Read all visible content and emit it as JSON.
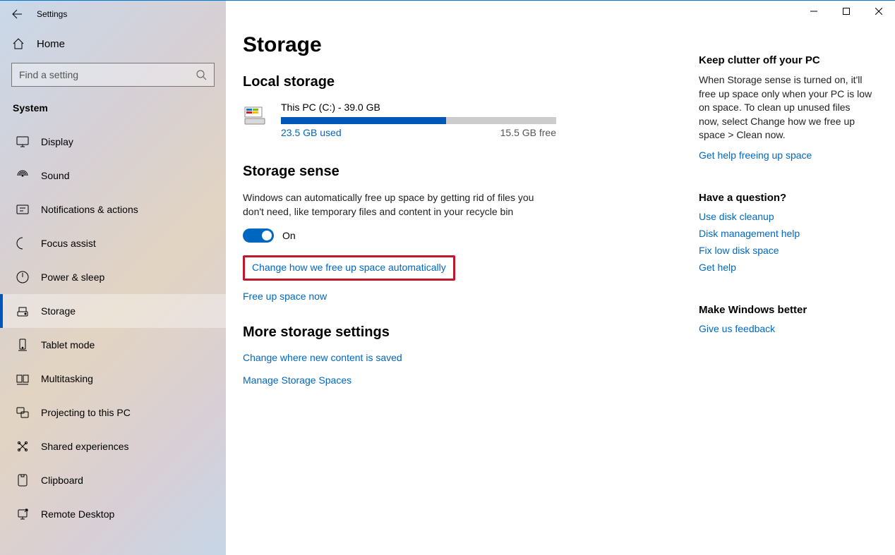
{
  "window": {
    "title": "Settings"
  },
  "sidebar": {
    "home": "Home",
    "search_placeholder": "Find a setting",
    "category": "System",
    "items": [
      {
        "label": "Display"
      },
      {
        "label": "Sound"
      },
      {
        "label": "Notifications & actions"
      },
      {
        "label": "Focus assist"
      },
      {
        "label": "Power & sleep"
      },
      {
        "label": "Storage"
      },
      {
        "label": "Tablet mode"
      },
      {
        "label": "Multitasking"
      },
      {
        "label": "Projecting to this PC"
      },
      {
        "label": "Shared experiences"
      },
      {
        "label": "Clipboard"
      },
      {
        "label": "Remote Desktop"
      }
    ],
    "selected_index": 5
  },
  "main": {
    "title": "Storage",
    "local_heading": "Local storage",
    "disk": {
      "name": "This PC (C:) - 39.0 GB",
      "used_text": "23.5 GB used",
      "free_text": "15.5 GB free",
      "used_pct": 60
    },
    "sense_heading": "Storage sense",
    "sense_desc": "Windows can automatically free up space by getting rid of files you don't need, like temporary files and content in your recycle bin",
    "toggle_label": "On",
    "link_change": "Change how we free up space automatically",
    "link_free": "Free up space now",
    "more_heading": "More storage settings",
    "link_content": "Change where new content is saved",
    "link_spaces": "Manage Storage Spaces"
  },
  "right": {
    "clutter_heading": "Keep clutter off your PC",
    "clutter_desc": "When Storage sense is turned on, it'll free up space only when your PC is low on space. To clean up unused files now, select Change how we free up space > Clean now.",
    "link_help_free": "Get help freeing up space",
    "question_heading": "Have a question?",
    "link_cleanup": "Use disk cleanup",
    "link_diskmgmt": "Disk management help",
    "link_fix": "Fix low disk space",
    "link_gethelp": "Get help",
    "better_heading": "Make Windows better",
    "link_feedback": "Give us feedback"
  }
}
